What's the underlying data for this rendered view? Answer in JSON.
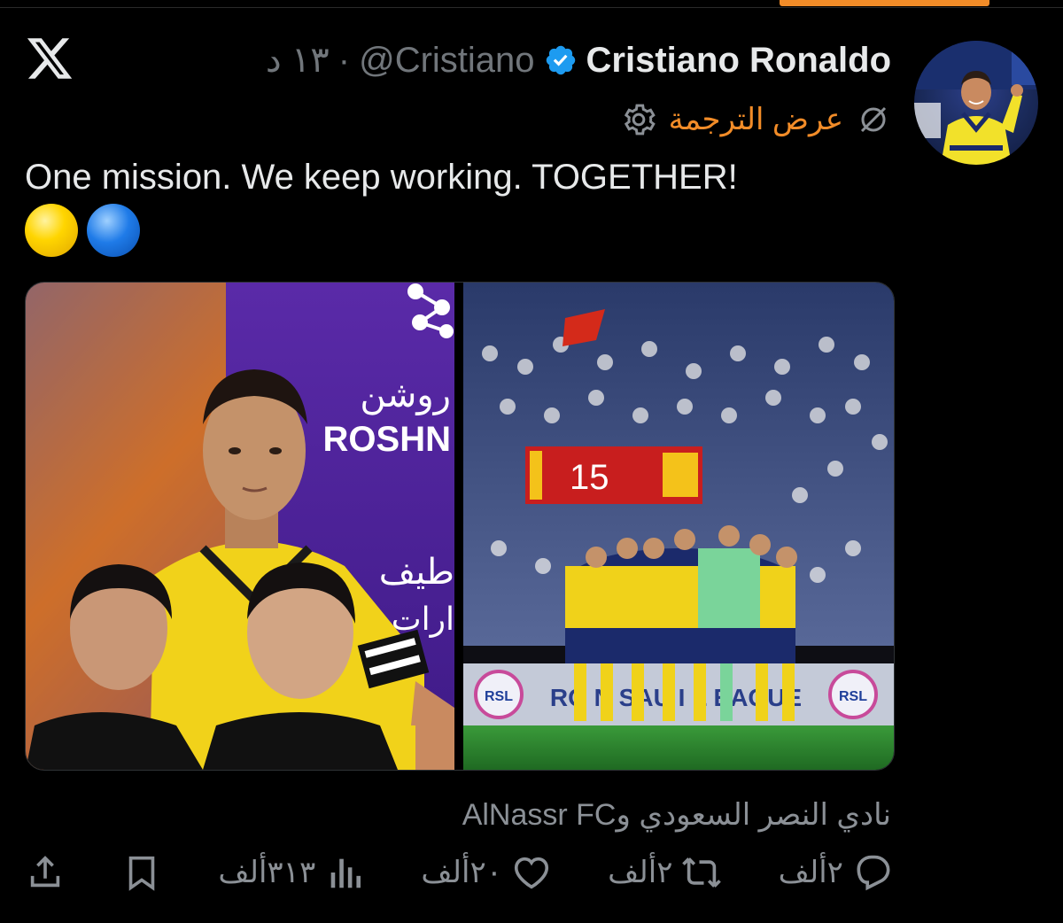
{
  "tweet": {
    "display_name": "Cristiano Ronaldo",
    "handle": "@Cristiano",
    "separator": "·",
    "time": "١٣ د",
    "translate_label": "عرض الترجمة",
    "text": "One mission. We keep working. TOGETHER!",
    "source": "نادي النصر السعودي وAlNassr FC"
  },
  "media": {
    "left": {
      "sponsor_arabic": "روشن",
      "sponsor_latin": "ROSHN",
      "sponsor_arabic_bottom": "طيف",
      "sponsor_arabic_bottom2": "ارات"
    },
    "right": {
      "banner_number": "15",
      "board_text": "RO  N  SAU  I  L  EAGUE",
      "rsl_label": "RSL"
    }
  },
  "actions": {
    "reply_count": "٢ألف",
    "repost_count": "٢ألف",
    "like_count": "٢٠ألف",
    "views_count": "٣١٣ألف"
  },
  "colors": {
    "background": "#000000",
    "text": "#e7e9ea",
    "secondary": "#71767b",
    "accent": "#f28c28",
    "verified": "#1d9bf0"
  }
}
